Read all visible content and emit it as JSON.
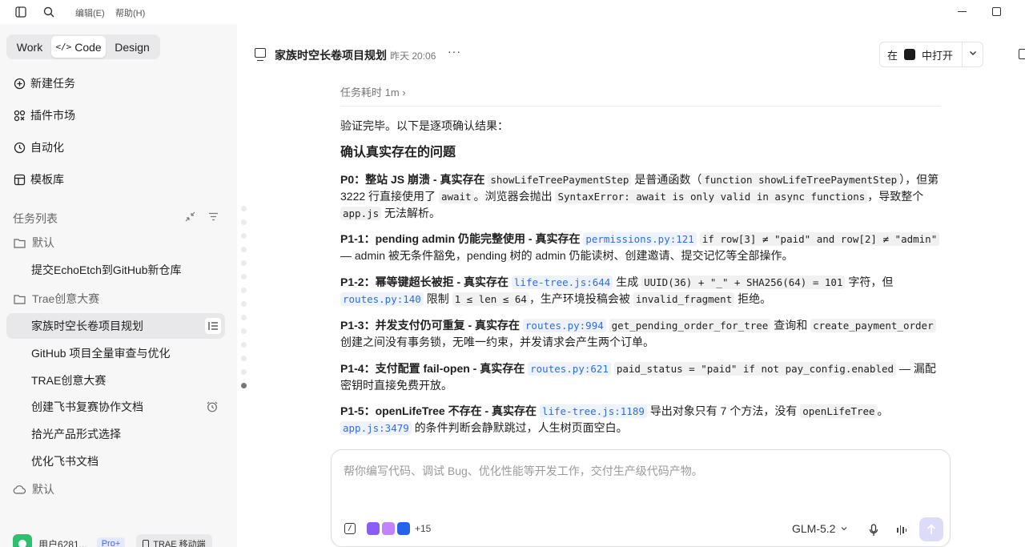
{
  "menu": {
    "edit": "编辑(E)",
    "help": "帮助(H)"
  },
  "sidebar": {
    "modes": [
      "Work",
      "Code",
      "Design"
    ],
    "active_mode": "Code",
    "nav": [
      {
        "label": "新建任务",
        "icon": "new-task-icon"
      },
      {
        "label": "插件市场",
        "icon": "plugin-icon"
      },
      {
        "label": "自动化",
        "icon": "clock-icon"
      },
      {
        "label": "模板库",
        "icon": "template-icon"
      }
    ],
    "tasks_title": "任务列表",
    "groups": [
      {
        "label": "默认",
        "icon": "folder-icon"
      },
      {
        "label": "Trae创意大赛",
        "icon": "folder-icon"
      },
      {
        "label": "默认",
        "icon": "cloud-icon"
      }
    ],
    "tasks": [
      "提交EchoEtch到GitHub新仓库",
      "家族时空长卷项目规划",
      "GitHub 项目全量审查与优化",
      "TRAE创意大赛",
      "创建飞书复赛协作文档",
      "拾光产品形式选择",
      "优化飞书文档"
    ],
    "active_task": "家族时空长卷项目规划",
    "user": {
      "name": "用户6281...",
      "badge": "Pro+",
      "mobile": "TRAE 移动端"
    }
  },
  "header": {
    "title": "家族时空长卷项目规划",
    "time": "昨天 20:06",
    "more": "···",
    "open_prefix": "在",
    "open_label": "中打开"
  },
  "content": {
    "task_time": "任务耗时 1m",
    "intro": "验证完毕。以下是逐项确认结果：",
    "heading": "确认真实存在的问题",
    "p0": {
      "lead": "P0：整站 JS 崩溃 - 真实存在",
      "c1": "showLifeTreePaymentStep",
      "t1": " 是普通函数（",
      "c2": "function showLifeTreePaymentStep",
      "t2": "），但第 3222 行直接使用了 ",
      "c3": "await",
      "t3": "。浏览器会抛出 ",
      "c4": "SyntaxError: await is only valid in async functions",
      "t4": "，导致整个 ",
      "c5": "app.js",
      "t5": " 无法解析。"
    },
    "p11": {
      "lead": "P1-1：pending admin 仍能完整使用 - 真实存在",
      "link": "permissions.py:121",
      "c1": "if row[3] ≠ \"paid\" and row[2] ≠ \"admin\"",
      "t1": " — admin 被无条件豁免，pending 树的 admin 仍能读树、创建邀请、提交记忆等全部操作。"
    },
    "p12": {
      "lead": "P1-2：幂等键超长被拒 - 真实存在",
      "link1": "life-tree.js:644",
      "t1": " 生成 ",
      "c1": "UUID(36) + \"_\" + SHA256(64) = 101",
      "t2": " 字符，但 ",
      "link2": "routes.py:140",
      "t3": " 限制 ",
      "c2": "1 ≤ len ≤ 64",
      "t4": "，生产环境投稿会被 ",
      "c3": "invalid_fragment",
      "t5": " 拒绝。"
    },
    "p13": {
      "lead": "P1-3：并发支付仍可重复 - 真实存在",
      "link": "routes.py:994",
      "c1": "get_pending_order_for_tree",
      "t1": " 查询和 ",
      "c2": "create_payment_order",
      "t2": " 创建之间没有事务锁，无唯一约束，并发请求会产生两个订单。"
    },
    "p14": {
      "lead": "P1-4：支付配置 fail-open - 真实存在",
      "link": "routes.py:621",
      "c1": "paid_status = \"paid\" if not pay_config.enabled",
      "t1": " — 漏配密钥时直接免费开放。"
    },
    "p15": {
      "lead": "P1-5：openLifeTree 不存在 - 真实存在",
      "link1": "life-tree.js:1189",
      "t1": " 导出对象只有 7 个方法，没有 ",
      "c1": "openLifeTree",
      "t2": "。",
      "link2": "app.js:3479",
      "t3": " 的条件判断会静默跳过，人生树页面空白。"
    }
  },
  "input": {
    "placeholder": "帮你编写代码、调试 Bug、优化性能等开发工作，交付生产级代码产物。",
    "plus_count": "+15",
    "model": "GLM-5.2"
  }
}
